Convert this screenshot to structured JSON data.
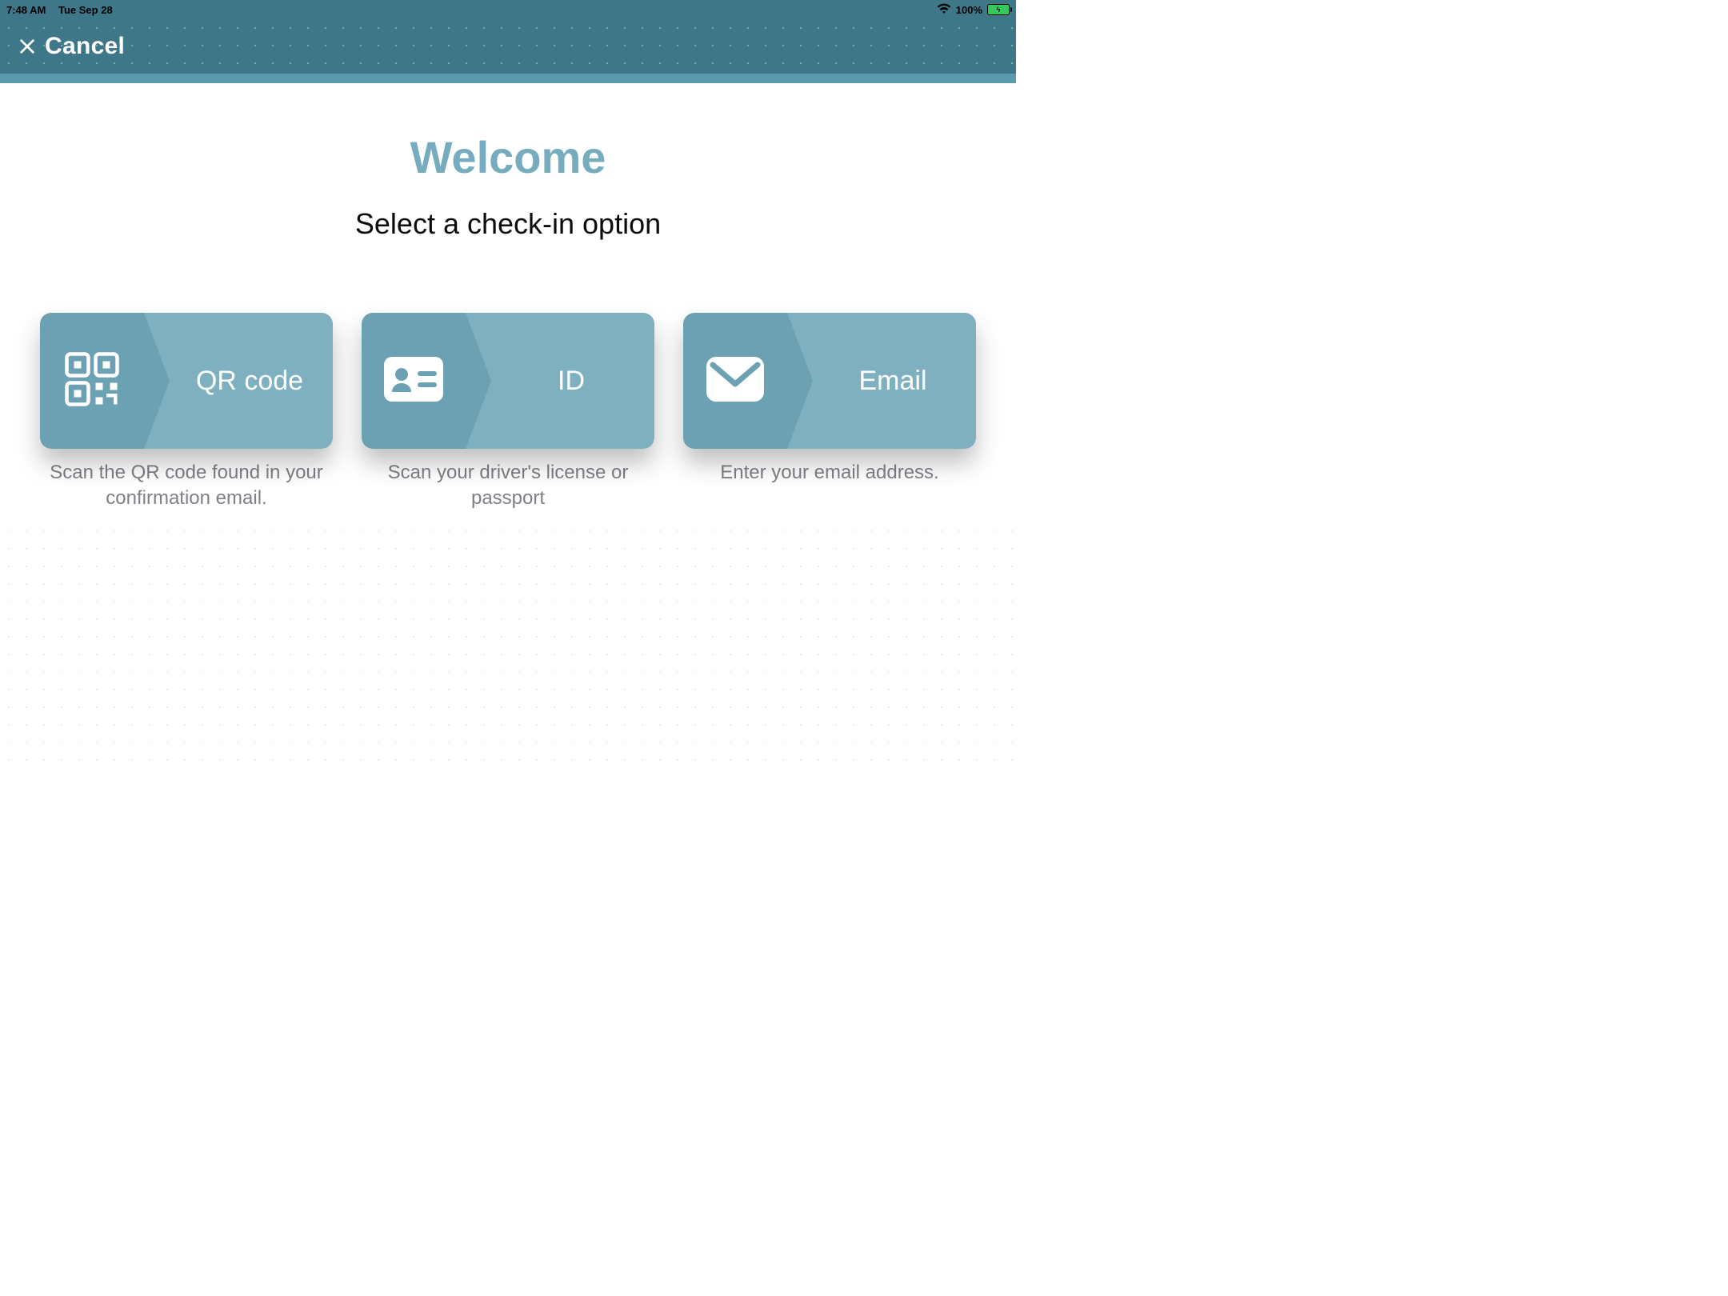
{
  "status": {
    "time": "7:48 AM",
    "date": "Tue Sep 28",
    "battery_pct": "100%"
  },
  "header": {
    "cancel_label": "Cancel"
  },
  "main": {
    "welcome": "Welcome",
    "subtitle": "Select a check-in option"
  },
  "cards": {
    "qr": {
      "title": "QR code",
      "caption": "Scan the QR code found in your confirmation email."
    },
    "id": {
      "title": "ID",
      "caption": "Scan your driver's license or passport"
    },
    "email": {
      "title": "Email",
      "caption": "Enter your email address."
    }
  }
}
